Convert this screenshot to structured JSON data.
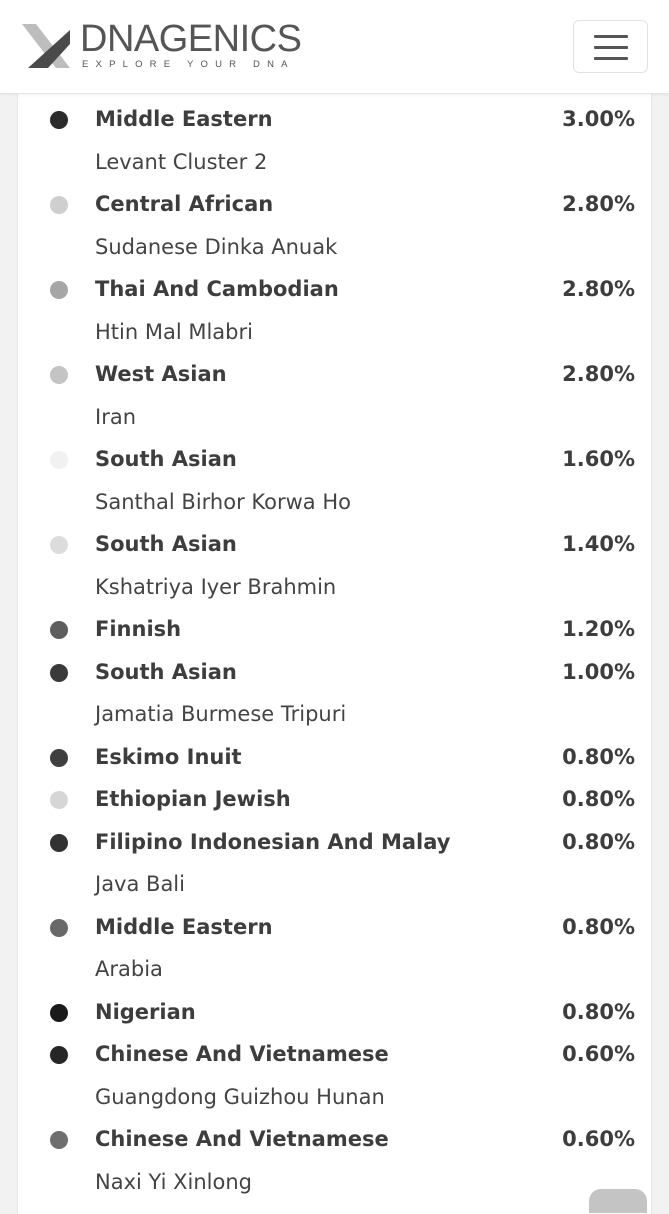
{
  "header": {
    "brand": "DNAGENICS",
    "tagline": "EXPLORE YOUR DNA",
    "menu_icon": "hamburger-icon"
  },
  "entries": [
    {
      "name": "Middle Eastern",
      "percent": "3.00%",
      "sub": "Levant Cluster 2",
      "color": "#2b2b2b"
    },
    {
      "name": "Central African",
      "percent": "2.80%",
      "sub": "Sudanese Dinka Anuak",
      "color": "#cfcfcf"
    },
    {
      "name": "Thai And Cambodian",
      "percent": "2.80%",
      "sub": "Htin Mal Mlabri",
      "color": "#a6a6a6"
    },
    {
      "name": "West Asian",
      "percent": "2.80%",
      "sub": "Iran",
      "color": "#c4c4c4"
    },
    {
      "name": "South Asian",
      "percent": "1.60%",
      "sub": "Santhal Birhor Korwa Ho",
      "color": "#f1f1f1"
    },
    {
      "name": "South Asian",
      "percent": "1.40%",
      "sub": "Kshatriya Iyer Brahmin",
      "color": "#dcdcdc"
    },
    {
      "name": "Finnish",
      "percent": "1.20%",
      "sub": "",
      "color": "#5e5e5e"
    },
    {
      "name": "South Asian",
      "percent": "1.00%",
      "sub": "Jamatia Burmese Tripuri",
      "color": "#3a3a3a"
    },
    {
      "name": "Eskimo Inuit",
      "percent": "0.80%",
      "sub": "",
      "color": "#3f3f3f"
    },
    {
      "name": "Ethiopian Jewish",
      "percent": "0.80%",
      "sub": "",
      "color": "#d6d6d6"
    },
    {
      "name": "Filipino Indonesian And Malay",
      "percent": "0.80%",
      "sub": "Java Bali",
      "color": "#333333"
    },
    {
      "name": "Middle Eastern",
      "percent": "0.80%",
      "sub": "Arabia",
      "color": "#686868"
    },
    {
      "name": "Nigerian",
      "percent": "0.80%",
      "sub": "",
      "color": "#1a1a1a"
    },
    {
      "name": "Chinese And Vietnamese",
      "percent": "0.60%",
      "sub": "Guangdong Guizhou Hunan",
      "color": "#262626"
    },
    {
      "name": "Chinese And Vietnamese",
      "percent": "0.60%",
      "sub": "Naxi Yi Xinlong",
      "color": "#6e6e6e"
    }
  ]
}
